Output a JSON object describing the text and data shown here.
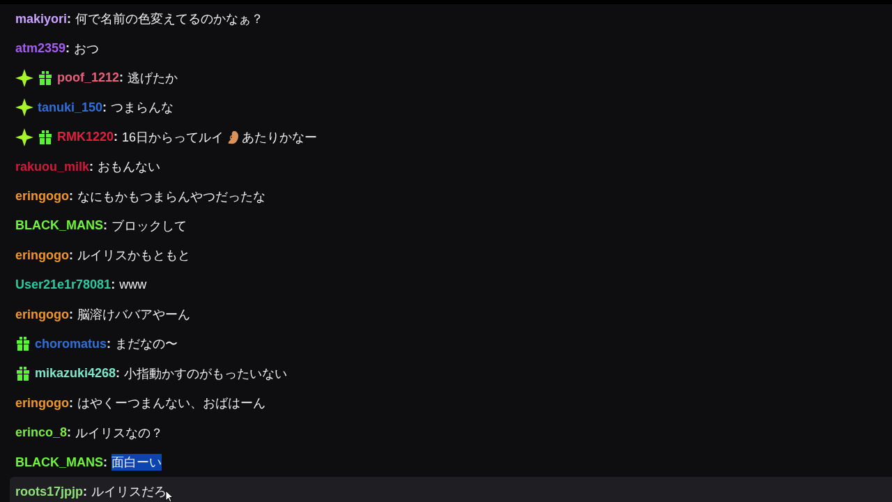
{
  "messages": [
    {
      "user": "makiyori",
      "color": "#c9a2ff",
      "separator": ":",
      "text": "何で名前の色変えてるのかなぁ？",
      "selected": false,
      "hovered": false
    },
    {
      "user": "atm2359",
      "color": "#a55cf0",
      "separator": ":",
      "text": "おつ",
      "selected": false,
      "hovered": false
    },
    {
      "user": "poof_1212",
      "color": "#e8607a",
      "badges": [
        {
          "kind": "sparkle"
        },
        {
          "kind": "gift"
        }
      ],
      "separator": ":",
      "text": "逃げたか",
      "selected": false,
      "hovered": false
    },
    {
      "user": "tanuki_150",
      "color": "#2f6fdb",
      "badges": [
        {
          "kind": "sparkle"
        }
      ],
      "separator": ":",
      "text": "つまらんな",
      "selected": false,
      "hovered": false
    },
    {
      "user": "RMK1220",
      "color": "#e0203f",
      "badges": [
        {
          "kind": "sparkle"
        },
        {
          "kind": "gift"
        }
      ],
      "separator": ":",
      "text": "16日からってルイ",
      "emote": true,
      "text_after": "あたりかなー",
      "selected": false,
      "hovered": false
    },
    {
      "user": "rakuou_milk",
      "color": "#d01a3a",
      "separator": ":",
      "text": "おもんない",
      "selected": false,
      "hovered": false
    },
    {
      "user": "eringogo",
      "color": "#f0962a",
      "separator": ":",
      "text": "なにもかもつまらんやつだったな",
      "selected": false,
      "hovered": false
    },
    {
      "user": "BLACK_MANS",
      "color": "#6ef53a",
      "separator": ":",
      "text": "ブロックして",
      "selected": false,
      "hovered": false
    },
    {
      "user": "eringogo",
      "color": "#f0962a",
      "separator": ":",
      "text": "ルイリスかもともと",
      "selected": false,
      "hovered": false
    },
    {
      "user": "User21e1r78081",
      "color": "#2ec9a0",
      "separator": ":",
      "text": "www",
      "selected": false,
      "hovered": false
    },
    {
      "user": "eringogo",
      "color": "#f0962a",
      "separator": ":",
      "text": "脳溶けババアやーん",
      "selected": false,
      "hovered": false
    },
    {
      "user": "choromatus",
      "color": "#2f6fdb",
      "badges": [
        {
          "kind": "gift"
        }
      ],
      "separator": ":",
      "text": "まだなの〜",
      "selected": false,
      "hovered": false
    },
    {
      "user": "mikazuki4268",
      "color": "#7ee8c8",
      "badges": [
        {
          "kind": "gift"
        }
      ],
      "separator": ":",
      "text": "小指動かすのがもったいない",
      "selected": false,
      "hovered": false
    },
    {
      "user": "eringogo",
      "color": "#f0962a",
      "separator": ":",
      "text": "はやくーつまんない、おばはーん",
      "selected": false,
      "hovered": false
    },
    {
      "user": "erinco_8",
      "color": "#7ee84a",
      "separator": ":",
      "text": "ルイリスなの？",
      "selected": false,
      "hovered": false
    },
    {
      "user": "BLACK_MANS",
      "color": "#6ef53a",
      "separator": ":",
      "text": "面白ーい",
      "selected": true,
      "hovered": false
    },
    {
      "user": "roots17jpjp",
      "color": "#8fe07a",
      "separator": ":",
      "text": "ルイリスだろ",
      "selected": false,
      "hovered": true
    }
  ]
}
